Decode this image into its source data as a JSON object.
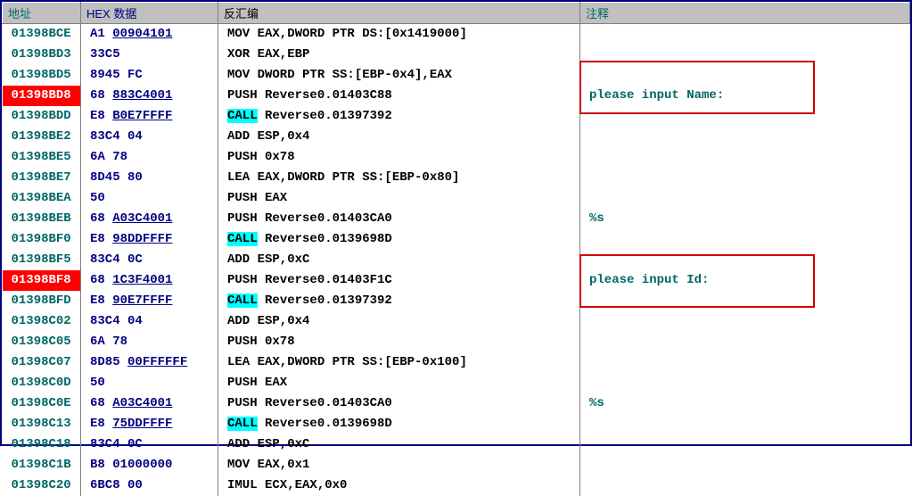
{
  "headers": {
    "addr": "地址",
    "hex": "HEX 数据",
    "asm": "反汇编",
    "cmt": "注释"
  },
  "rows": [
    {
      "addr": "01398BCE",
      "hex1": "A1 ",
      "hexU": "00904101",
      "hex2": "",
      "asm1": "MOV EAX,DWORD PTR DS:[0x1419000]",
      "cmt": "",
      "hl": false,
      "call": false
    },
    {
      "addr": "01398BD3",
      "hex1": "33C5",
      "hexU": "",
      "hex2": "",
      "asm1": "XOR EAX,EBP",
      "cmt": "",
      "hl": false,
      "call": false
    },
    {
      "addr": "01398BD5",
      "hex1": "8945 FC",
      "hexU": "",
      "hex2": "",
      "asm1": "MOV DWORD PTR SS:[EBP-0x4],EAX",
      "cmt": "",
      "hl": false,
      "call": false
    },
    {
      "addr": "01398BD8",
      "hex1": "68 ",
      "hexU": "883C4001",
      "hex2": "",
      "asm1": "PUSH Reverse0.01403C88",
      "cmt": "please input Name:",
      "hl": true,
      "call": false
    },
    {
      "addr": "01398BDD",
      "hex1": "E8 ",
      "hexU": "B0E7FFFF",
      "hex2": "",
      "asm1": "",
      "asmC": "CALL",
      "asm2": " Reverse0.01397392",
      "cmt": "",
      "hl": false,
      "call": true
    },
    {
      "addr": "01398BE2",
      "hex1": "83C4 04",
      "hexU": "",
      "hex2": "",
      "asm1": "ADD ESP,0x4",
      "cmt": "",
      "hl": false,
      "call": false
    },
    {
      "addr": "01398BE5",
      "hex1": "6A 78",
      "hexU": "",
      "hex2": "",
      "asm1": "PUSH 0x78",
      "cmt": "",
      "hl": false,
      "call": false
    },
    {
      "addr": "01398BE7",
      "hex1": "8D45 80",
      "hexU": "",
      "hex2": "",
      "asm1": "LEA EAX,DWORD PTR SS:[EBP-0x80]",
      "cmt": "",
      "hl": false,
      "call": false
    },
    {
      "addr": "01398BEA",
      "hex1": "50",
      "hexU": "",
      "hex2": "",
      "asm1": "PUSH EAX",
      "cmt": "",
      "hl": false,
      "call": false
    },
    {
      "addr": "01398BEB",
      "hex1": "68 ",
      "hexU": "A03C4001",
      "hex2": "",
      "asm1": "PUSH Reverse0.01403CA0",
      "cmt": "%s",
      "hl": false,
      "call": false
    },
    {
      "addr": "01398BF0",
      "hex1": "E8 ",
      "hexU": "98DDFFFF",
      "hex2": "",
      "asm1": "",
      "asmC": "CALL",
      "asm2": " Reverse0.0139698D",
      "cmt": "",
      "hl": false,
      "call": true
    },
    {
      "addr": "01398BF5",
      "hex1": "83C4 0C",
      "hexU": "",
      "hex2": "",
      "asm1": "ADD ESP,0xC",
      "cmt": "",
      "hl": false,
      "call": false
    },
    {
      "addr": "01398BF8",
      "hex1": "68 ",
      "hexU": "1C3F4001",
      "hex2": "",
      "asm1": "PUSH Reverse0.01403F1C",
      "cmt": "please input Id:",
      "hl": true,
      "call": false
    },
    {
      "addr": "01398BFD",
      "hex1": "E8 ",
      "hexU": "90E7FFFF",
      "hex2": "",
      "asm1": "",
      "asmC": "CALL",
      "asm2": " Reverse0.01397392",
      "cmt": "",
      "hl": false,
      "call": true
    },
    {
      "addr": "01398C02",
      "hex1": "83C4 04",
      "hexU": "",
      "hex2": "",
      "asm1": "ADD ESP,0x4",
      "cmt": "",
      "hl": false,
      "call": false
    },
    {
      "addr": "01398C05",
      "hex1": "6A 78",
      "hexU": "",
      "hex2": "",
      "asm1": "PUSH 0x78",
      "cmt": "",
      "hl": false,
      "call": false
    },
    {
      "addr": "01398C07",
      "hex1": "8D85 ",
      "hexU": "00FFFFFF",
      "hex2": "",
      "asm1": "LEA EAX,DWORD PTR SS:[EBP-0x100]",
      "cmt": "",
      "hl": false,
      "call": false
    },
    {
      "addr": "01398C0D",
      "hex1": "50",
      "hexU": "",
      "hex2": "",
      "asm1": "PUSH EAX",
      "cmt": "",
      "hl": false,
      "call": false
    },
    {
      "addr": "01398C0E",
      "hex1": "68 ",
      "hexU": "A03C4001",
      "hex2": "",
      "asm1": "PUSH Reverse0.01403CA0",
      "cmt": "%s",
      "hl": false,
      "call": false
    },
    {
      "addr": "01398C13",
      "hex1": "E8 ",
      "hexU": "75DDFFFF",
      "hex2": "",
      "asm1": "",
      "asmC": "CALL",
      "asm2": " Reverse0.0139698D",
      "cmt": "",
      "hl": false,
      "call": true
    },
    {
      "addr": "01398C18",
      "hex1": "83C4 0C",
      "hexU": "",
      "hex2": "",
      "asm1": "ADD ESP,0xC",
      "cmt": "",
      "hl": false,
      "call": false
    },
    {
      "addr": "01398C1B",
      "hex1": "B8 01000000",
      "hexU": "",
      "hex2": "",
      "asm1": "MOV EAX,0x1",
      "cmt": "",
      "hl": false,
      "call": false
    },
    {
      "addr": "01398C20",
      "hex1": "6BC8 00",
      "hexU": "",
      "hex2": "",
      "asm1": "IMUL ECX,EAX,0x0",
      "cmt": "",
      "hl": false,
      "call": false
    }
  ]
}
